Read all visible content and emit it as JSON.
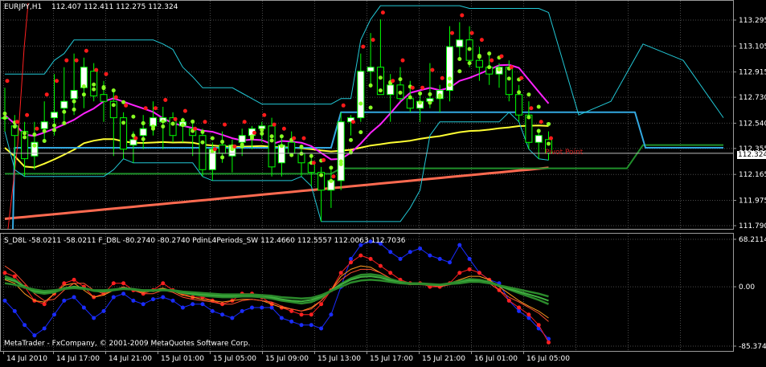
{
  "header": {
    "symbol": "EURJPY,H1",
    "ohlc": "112.407 112.411 112.275 112.324"
  },
  "sub_header": {
    "text": "S_D8L -58.0211 -58.0211  F_D8L -80.2740 -80.2740  PdinL4Periods_SW 112.4660 112.5557 112.0063 112.7036"
  },
  "watermark": "MetaTrader - FxCompany, © 2001-2009 MetaQuotes Software Corp.",
  "price_marker": "112.324",
  "chart_annotation": "Pivot Point",
  "colors": {
    "background": "#000000",
    "grid": "#4a4a4a",
    "bull_candle": "#ffffff",
    "bear_candle": "#000000",
    "wick": "#00ff00",
    "channel_upper": "#22c8d6",
    "pivot_line": "#33a8e0",
    "support_line": "#1f8f2a",
    "ma_magenta": "#ff22ff",
    "ma_yellow": "#ffff33",
    "ma_salmon": "#ff6a50",
    "dots_green": "#88ff22",
    "dots_red": "#ff1a1a",
    "osc_blue": "#1a2cff",
    "osc_red": "#ff2020",
    "osc_orange": "#ff9a20",
    "osc_green": "#2b8a2b",
    "osc_green_light": "#40b040"
  },
  "chart_data": [
    {
      "type": "candlestick",
      "title": "EURJPY,H1",
      "ylim": [
        111.79,
        113.295
      ],
      "y_ticks": [
        "113.295",
        "113.105",
        "112.915",
        "112.730",
        "112.540",
        "112.355",
        "112.165",
        "111.975",
        "111.790"
      ],
      "x_ticks": [
        "14 Jul 2010",
        "14 Jul 17:00",
        "14 Jul 21:00",
        "15 Jul 01:00",
        "15 Jul 05:00",
        "15 Jul 09:00",
        "15 Jul 13:00",
        "15 Jul 17:00",
        "15 Jul 21:00",
        "16 Jul 01:00",
        "16 Jul 05:00"
      ],
      "candles": [
        {
          "o": 112.58,
          "h": 112.8,
          "l": 112.48,
          "c": 112.58
        },
        {
          "o": 112.52,
          "h": 112.6,
          "l": 112.2,
          "c": 112.45
        },
        {
          "o": 112.48,
          "h": 112.55,
          "l": 112.15,
          "c": 112.28
        },
        {
          "o": 112.3,
          "h": 112.55,
          "l": 112.2,
          "c": 112.4
        },
        {
          "o": 112.5,
          "h": 112.7,
          "l": 112.4,
          "c": 112.55
        },
        {
          "o": 112.58,
          "h": 112.9,
          "l": 112.45,
          "c": 112.62
        },
        {
          "o": 112.65,
          "h": 112.95,
          "l": 112.55,
          "c": 112.7
        },
        {
          "o": 112.72,
          "h": 113.05,
          "l": 112.6,
          "c": 112.78
        },
        {
          "o": 112.8,
          "h": 113.02,
          "l": 112.65,
          "c": 112.95
        },
        {
          "o": 112.92,
          "h": 112.98,
          "l": 112.7,
          "c": 112.74
        },
        {
          "o": 112.75,
          "h": 112.85,
          "l": 112.55,
          "c": 112.7
        },
        {
          "o": 112.7,
          "h": 112.78,
          "l": 112.3,
          "c": 112.58
        },
        {
          "o": 112.58,
          "h": 112.62,
          "l": 112.28,
          "c": 112.35
        },
        {
          "o": 112.38,
          "h": 112.48,
          "l": 112.25,
          "c": 112.42
        },
        {
          "o": 112.45,
          "h": 112.6,
          "l": 112.35,
          "c": 112.5
        },
        {
          "o": 112.52,
          "h": 112.7,
          "l": 112.45,
          "c": 112.58
        },
        {
          "o": 112.55,
          "h": 112.66,
          "l": 112.35,
          "c": 112.58
        },
        {
          "o": 112.58,
          "h": 112.62,
          "l": 112.4,
          "c": 112.45
        },
        {
          "o": 112.52,
          "h": 112.58,
          "l": 112.4,
          "c": 112.55
        },
        {
          "o": 112.5,
          "h": 112.55,
          "l": 112.3,
          "c": 112.45
        },
        {
          "o": 112.45,
          "h": 112.5,
          "l": 112.15,
          "c": 112.2
        },
        {
          "o": 112.2,
          "h": 112.4,
          "l": 112.12,
          "c": 112.35
        },
        {
          "o": 112.38,
          "h": 112.48,
          "l": 112.25,
          "c": 112.32
        },
        {
          "o": 112.3,
          "h": 112.42,
          "l": 112.18,
          "c": 112.38
        },
        {
          "o": 112.4,
          "h": 112.5,
          "l": 112.3,
          "c": 112.45
        },
        {
          "o": 112.45,
          "h": 112.52,
          "l": 112.35,
          "c": 112.5
        },
        {
          "o": 112.5,
          "h": 112.55,
          "l": 112.4,
          "c": 112.52
        },
        {
          "o": 112.52,
          "h": 112.58,
          "l": 112.15,
          "c": 112.22
        },
        {
          "o": 112.25,
          "h": 112.45,
          "l": 112.15,
          "c": 112.38
        },
        {
          "o": 112.4,
          "h": 112.48,
          "l": 112.3,
          "c": 112.32
        },
        {
          "o": 112.32,
          "h": 112.38,
          "l": 112.15,
          "c": 112.25
        },
        {
          "o": 112.25,
          "h": 112.3,
          "l": 112.08,
          "c": 112.18
        },
        {
          "o": 112.18,
          "h": 112.22,
          "l": 111.82,
          "c": 112.05
        },
        {
          "o": 112.05,
          "h": 112.2,
          "l": 111.92,
          "c": 112.12
        },
        {
          "o": 112.12,
          "h": 112.62,
          "l": 112.05,
          "c": 112.55
        },
        {
          "o": 112.55,
          "h": 112.6,
          "l": 112.45,
          "c": 112.58
        },
        {
          "o": 112.58,
          "h": 113.05,
          "l": 112.55,
          "c": 112.92
        },
        {
          "o": 112.92,
          "h": 113.2,
          "l": 112.8,
          "c": 112.95
        },
        {
          "o": 112.95,
          "h": 113.3,
          "l": 112.9,
          "c": 112.75
        },
        {
          "o": 112.75,
          "h": 112.9,
          "l": 112.55,
          "c": 112.82
        },
        {
          "o": 112.82,
          "h": 112.95,
          "l": 112.7,
          "c": 112.72
        },
        {
          "o": 112.72,
          "h": 112.85,
          "l": 112.62,
          "c": 112.65
        },
        {
          "o": 112.65,
          "h": 112.75,
          "l": 112.55,
          "c": 112.7
        },
        {
          "o": 112.7,
          "h": 112.98,
          "l": 112.65,
          "c": 112.72
        },
        {
          "o": 112.72,
          "h": 112.82,
          "l": 112.62,
          "c": 112.78
        },
        {
          "o": 112.78,
          "h": 113.25,
          "l": 112.7,
          "c": 113.1
        },
        {
          "o": 113.1,
          "h": 113.28,
          "l": 113.0,
          "c": 113.15
        },
        {
          "o": 113.15,
          "h": 113.25,
          "l": 112.95,
          "c": 113.0
        },
        {
          "o": 113.0,
          "h": 113.1,
          "l": 112.85,
          "c": 112.95
        },
        {
          "o": 112.95,
          "h": 113.05,
          "l": 112.82,
          "c": 112.9
        },
        {
          "o": 112.9,
          "h": 112.98,
          "l": 112.8,
          "c": 112.95
        },
        {
          "o": 112.95,
          "h": 113.0,
          "l": 112.7,
          "c": 112.75
        },
        {
          "o": 112.75,
          "h": 112.82,
          "l": 112.55,
          "c": 112.6
        },
        {
          "o": 112.6,
          "h": 112.7,
          "l": 112.35,
          "c": 112.4
        },
        {
          "o": 112.4,
          "h": 112.5,
          "l": 112.28,
          "c": 112.45
        },
        {
          "o": 112.42,
          "h": 112.48,
          "l": 112.27,
          "c": 112.32
        }
      ]
    },
    {
      "type": "line",
      "title": "S_D8L -58.0211 -58.0211  F_D8L -80.2740 -80.2740",
      "ylim": [
        -85.3743,
        68.2114
      ],
      "y_ticks": [
        "68.2114",
        "0.00",
        "-85.3743"
      ],
      "series": [
        {
          "values": [
            -20,
            -35,
            -55,
            -70,
            -60,
            -40,
            -20,
            -15,
            -30,
            -45,
            -35,
            -15,
            -10,
            -20,
            -25,
            -18,
            -15,
            -20,
            -30,
            -25,
            -25,
            -35,
            -40,
            -45,
            -35,
            -30,
            -30,
            -30,
            -45,
            -50,
            -55,
            -55,
            -60,
            -40,
            0,
            40,
            60,
            65,
            62,
            50,
            40,
            50,
            55,
            45,
            40,
            35,
            60,
            40,
            20,
            10,
            5,
            -20,
            -35,
            -45,
            -60,
            -75
          ]
        },
        {
          "values": [
            20,
            15,
            0,
            -20,
            -25,
            -10,
            5,
            10,
            0,
            -15,
            -10,
            5,
            5,
            -5,
            -10,
            -5,
            5,
            -5,
            -10,
            -15,
            -15,
            -20,
            -25,
            -20,
            -10,
            -10,
            -15,
            -25,
            -30,
            -35,
            -40,
            -40,
            -25,
            -5,
            20,
            35,
            45,
            40,
            30,
            20,
            10,
            5,
            5,
            0,
            0,
            5,
            20,
            25,
            20,
            10,
            -5,
            -20,
            -30,
            -40,
            -55,
            -80
          ]
        },
        {
          "values": [
            10,
            5,
            -10,
            -20,
            -22,
            -10,
            2,
            5,
            -5,
            -15,
            -12,
            -5,
            -2,
            -5,
            -8,
            -5,
            -2,
            -6,
            -12,
            -15,
            -18,
            -20,
            -22,
            -20,
            -18,
            -18,
            -20,
            -25,
            -30,
            -32,
            -35,
            -30,
            -20,
            -5,
            15,
            25,
            30,
            28,
            20,
            12,
            5,
            5,
            5,
            2,
            2,
            5,
            10,
            15,
            15,
            10,
            0,
            -10,
            -20,
            -28,
            -35,
            -45
          ]
        },
        {
          "values": [
            30,
            20,
            5,
            -10,
            -20,
            -18,
            -5,
            5,
            5,
            -5,
            -10,
            -5,
            0,
            -5,
            -10,
            -10,
            -5,
            -8,
            -15,
            -18,
            -20,
            -22,
            -25,
            -25,
            -20,
            -18,
            -20,
            -22,
            -28,
            -32,
            -35,
            -32,
            -20,
            -5,
            10,
            20,
            25,
            25,
            20,
            12,
            5,
            3,
            3,
            2,
            0,
            3,
            8,
            12,
            10,
            5,
            -5,
            -15,
            -22,
            -30,
            -38,
            -50
          ]
        },
        {
          "values": [
            15,
            10,
            0,
            -8,
            -10,
            -8,
            -3,
            0,
            -2,
            -6,
            -7,
            -5,
            -3,
            -4,
            -6,
            -6,
            -5,
            -6,
            -9,
            -11,
            -13,
            -14,
            -15,
            -15,
            -14,
            -14,
            -15,
            -17,
            -20,
            -22,
            -24,
            -22,
            -16,
            -6,
            4,
            12,
            17,
            18,
            16,
            11,
            7,
            5,
            5,
            4,
            3,
            5,
            8,
            11,
            10,
            7,
            2,
            -4,
            -9,
            -14,
            -19,
            -25
          ]
        },
        {
          "values": [
            12,
            8,
            0,
            -6,
            -8,
            -6,
            -2,
            0,
            -2,
            -5,
            -6,
            -4,
            -2,
            -3,
            -5,
            -5,
            -4,
            -5,
            -8,
            -10,
            -11,
            -12,
            -13,
            -13,
            -12,
            -12,
            -13,
            -15,
            -18,
            -20,
            -21,
            -19,
            -14,
            -5,
            3,
            10,
            14,
            15,
            13,
            9,
            6,
            4,
            4,
            3,
            2,
            4,
            6,
            9,
            8,
            6,
            1,
            -3,
            -7,
            -11,
            -15,
            -20
          ]
        },
        {
          "values": [
            5,
            3,
            -1,
            -4,
            -6,
            -5,
            -3,
            -2,
            -3,
            -5,
            -5,
            -4,
            -3,
            -4,
            -5,
            -5,
            -5,
            -5,
            -7,
            -8,
            -9,
            -10,
            -11,
            -11,
            -11,
            -11,
            -12,
            -13,
            -15,
            -16,
            -17,
            -16,
            -12,
            -6,
            0,
            6,
            9,
            10,
            9,
            7,
            5,
            4,
            4,
            3,
            3,
            4,
            5,
            7,
            7,
            5,
            2,
            -1,
            -4,
            -7,
            -10,
            -14
          ]
        }
      ]
    }
  ]
}
